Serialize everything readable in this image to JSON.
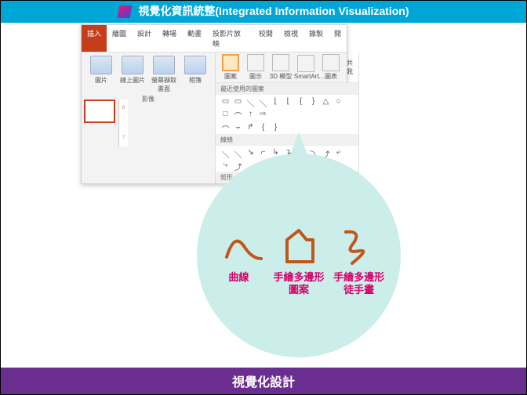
{
  "banner": {
    "title": "視覺化資訊統整(Integrated Information Visualization)"
  },
  "footer": {
    "title": "視覺化設計"
  },
  "ribbon": {
    "tabs": [
      "插入",
      "繪圖",
      "設計",
      "轉場",
      "動畫",
      "投影片放映",
      "校閱",
      "檢視",
      "錄製",
      "開"
    ],
    "active_tab": "插入",
    "group_images": {
      "items": [
        "圖片",
        "線上圖片",
        "螢幕擷取畫面",
        "相簿"
      ],
      "label": "影像"
    },
    "group_illust": {
      "items": [
        "圖案",
        "圖示",
        "3D 模型",
        "SmartArt...",
        "圖表"
      ],
      "more": "我"
    },
    "shapes": {
      "sec_recent": "最近使用的圖案",
      "sec_lines": "線條",
      "sec_rects": "矩形",
      "recent_glyphs": [
        "▭",
        "▭",
        "＼",
        "＼",
        "⌊",
        "⌊",
        "{",
        "}",
        "△",
        "○",
        "□",
        "⌒",
        "↑",
        "⇨"
      ],
      "recent_glyphs2": [
        "⌒",
        "⌣",
        "↱",
        "{",
        "}"
      ],
      "line_glyphs": [
        "＼",
        "＼",
        "↘",
        "⌐",
        "↳",
        "↴",
        "↲",
        "⤵",
        "⤴",
        "⤶",
        "⤷",
        "⤴"
      ]
    }
  },
  "ruler": {
    "marks": [
      "8",
      "",
      "7"
    ]
  },
  "drop": {
    "labels": [
      "曲線",
      "手繪多邊形\n圖案",
      "手繪多邊形\n徒手畫"
    ]
  }
}
